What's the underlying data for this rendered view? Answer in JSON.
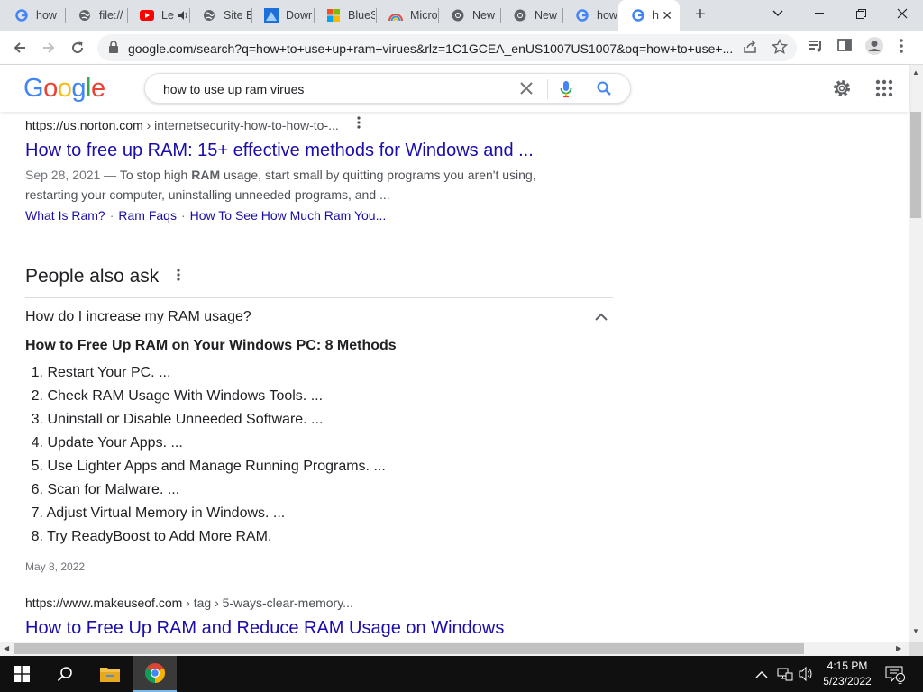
{
  "browser": {
    "tabs": [
      {
        "label": "how",
        "favicon": "google-icon"
      },
      {
        "label": "file://",
        "favicon": "globe-icon"
      },
      {
        "label": "Le",
        "favicon": "youtube-icon",
        "audio": "speaker-icon"
      },
      {
        "label": "Site E",
        "favicon": "globe-icon"
      },
      {
        "label": "Dowr",
        "favicon": "bluesky-icon"
      },
      {
        "label": "BlueS",
        "favicon": "windows-logo-icon"
      },
      {
        "label": "Micro",
        "favicon": "rainbow-icon"
      },
      {
        "label": "New",
        "favicon": "chrome-icon"
      },
      {
        "label": "New",
        "favicon": "chrome-icon"
      },
      {
        "label": "how",
        "favicon": "google-icon"
      },
      {
        "label": "h",
        "favicon": "google-icon",
        "active": true
      }
    ],
    "address": {
      "url": "google.com/search?q=how+to+use+up+ram+virues&rlz=1C1GCEA_enUS1007US1007&oq=how+to+use+..."
    }
  },
  "google": {
    "logo": [
      "G",
      "o",
      "o",
      "g",
      "l",
      "e"
    ],
    "logo_colors": [
      "#4285f4",
      "#ea4335",
      "#fbbc05",
      "#4285f4",
      "#34a853",
      "#ea4335"
    ],
    "query": "how to use up ram virues"
  },
  "results": [
    {
      "url_host": "https://us.norton.com",
      "url_path": " › internetsecurity-how-to-how-to-...",
      "title": "How to free up RAM: 15+ effective methods for Windows and ...",
      "snippet_date": "Sep 28, 2021 — ",
      "snippet_pre": "To stop high ",
      "snippet_bold": "RAM",
      "snippet_post": " usage, start small by quitting programs you aren't using, restarting your computer, uninstalling unneeded programs, and ...",
      "sitelinks": [
        "What Is Ram?",
        "Ram Faqs",
        "How To See How Much Ram You..."
      ]
    },
    {
      "url_host": "https://www.makeuseof.com",
      "url_path": " › tag › 5-ways-clear-memory...",
      "title": "How to Free Up RAM and Reduce RAM Usage on Windows"
    }
  ],
  "people_also_ask": {
    "heading": "People also ask",
    "question": "How do I increase my RAM usage?",
    "answer_title": "How to Free Up RAM on Your Windows PC: 8 Methods",
    "items": [
      "Restart Your PC. ...",
      "Check RAM Usage With Windows Tools. ...",
      "Uninstall or Disable Unneeded Software. ...",
      "Update Your Apps. ...",
      "Use Lighter Apps and Manage Running Programs. ...",
      "Scan for Malware. ...",
      "Adjust Virtual Memory in Windows. ...",
      "Try ReadyBoost to Add More RAM."
    ],
    "date": "May 8, 2022"
  },
  "taskbar": {
    "time": "4:15 PM",
    "date": "5/23/2022",
    "notification_count": "1"
  }
}
